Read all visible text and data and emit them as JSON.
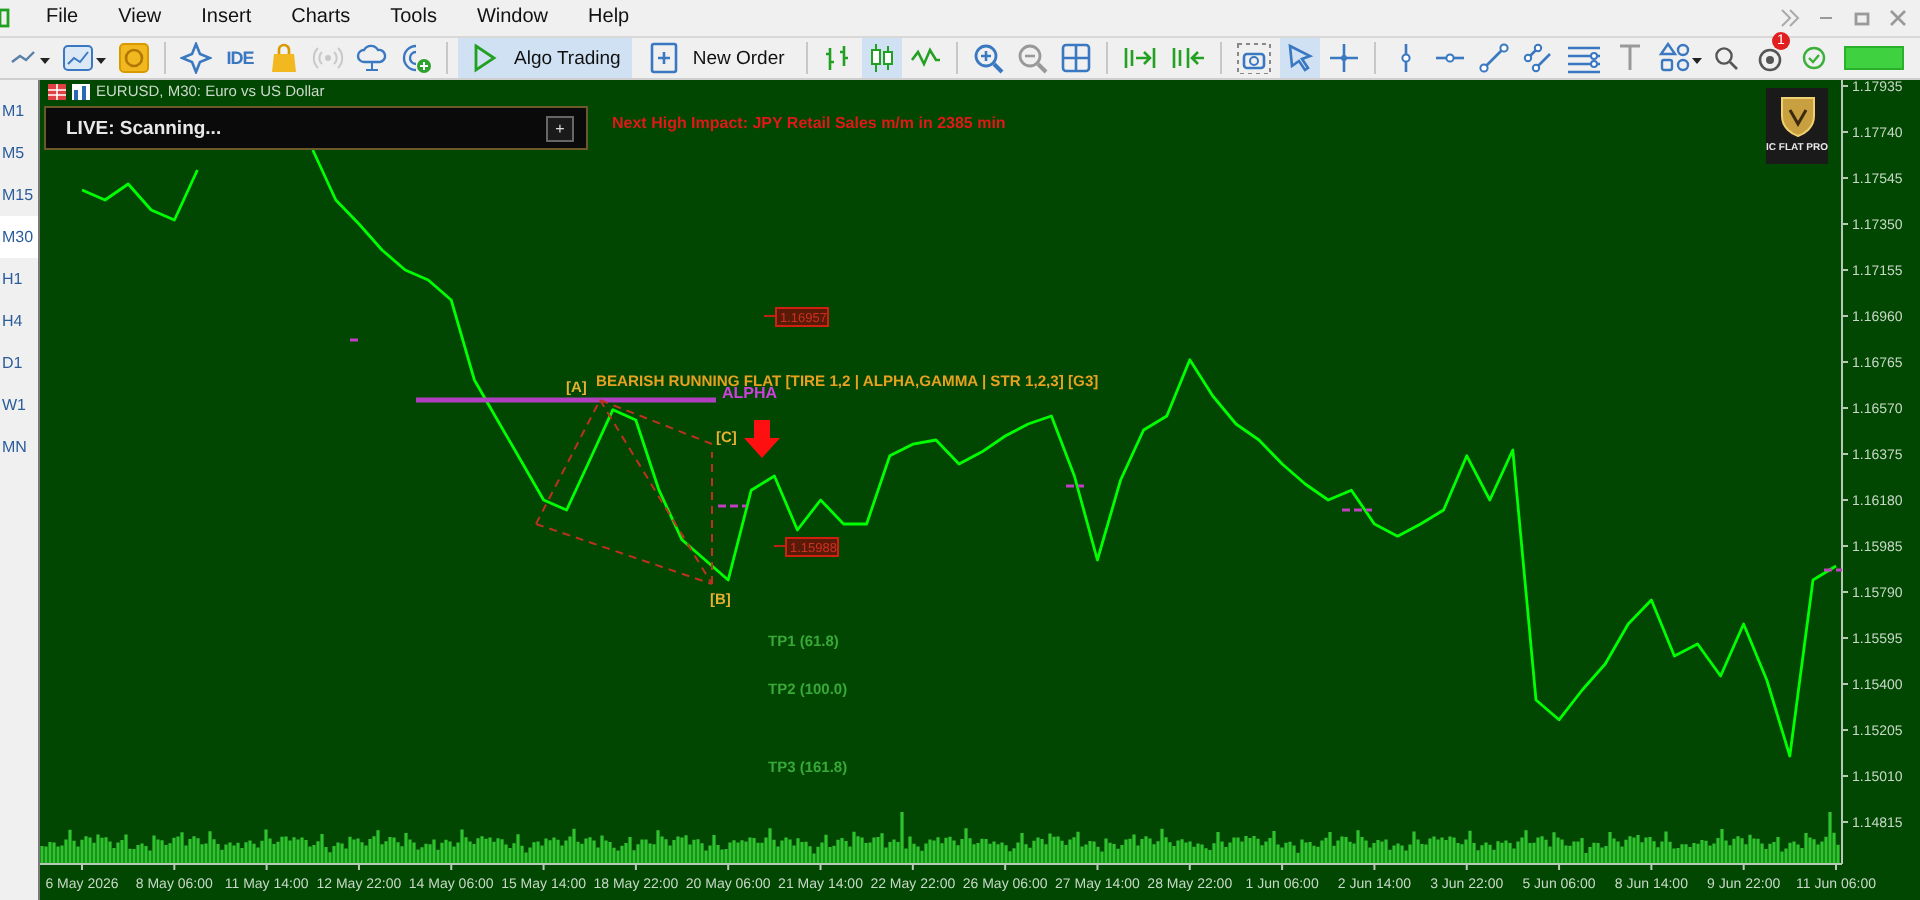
{
  "menu": [
    "File",
    "View",
    "Insert",
    "Charts",
    "Tools",
    "Window",
    "Help"
  ],
  "toolbar": [
    {
      "kind": "icon",
      "selected": false,
      "disabled": false
    },
    {
      "kind": "icon",
      "selected": false,
      "disabled": false
    },
    {
      "kind": "icon",
      "selected": false,
      "disabled": false
    },
    {
      "kind": "separator"
    },
    {
      "kind": "icon",
      "selected": false,
      "disabled": false
    },
    {
      "kind": "text_icon",
      "label": "IDE",
      "selected": false,
      "disabled": false
    },
    {
      "kind": "icon",
      "selected": false,
      "disabled": false
    },
    {
      "kind": "icon",
      "selected": false,
      "disabled": true
    },
    {
      "kind": "icon",
      "selected": false,
      "disabled": false
    },
    {
      "kind": "icon",
      "selected": false,
      "disabled": false
    },
    {
      "kind": "separator"
    },
    {
      "kind": "button",
      "label": "Algo Trading",
      "selected": true,
      "disabled": false
    },
    {
      "kind": "button",
      "label": "New Order",
      "selected": false,
      "disabled": false
    },
    {
      "kind": "separator"
    },
    {
      "kind": "icon",
      "selected": false,
      "disabled": false
    },
    {
      "kind": "icon",
      "selected": true,
      "disabled": false
    },
    {
      "kind": "icon",
      "selected": false,
      "disabled": false
    },
    {
      "kind": "separator"
    },
    {
      "kind": "icon",
      "selected": false,
      "disabled": false
    },
    {
      "kind": "icon",
      "selected": false,
      "disabled": false
    },
    {
      "kind": "icon",
      "selected": false,
      "disabled": false
    },
    {
      "kind": "separator"
    },
    {
      "kind": "icon",
      "selected": false,
      "disabled": false
    },
    {
      "kind": "icon",
      "selected": false,
      "disabled": false
    },
    {
      "kind": "separator"
    },
    {
      "kind": "icon",
      "selected": false,
      "disabled": false
    },
    {
      "kind": "icon",
      "selected": true,
      "disabled": false
    },
    {
      "kind": "icon",
      "selected": false,
      "disabled": false
    },
    {
      "kind": "separator"
    },
    {
      "kind": "icon",
      "selected": false,
      "disabled": false
    },
    {
      "kind": "icon",
      "selected": false,
      "disabled": false
    },
    {
      "kind": "icon",
      "selected": false,
      "disabled": false
    },
    {
      "kind": "icon",
      "selected": false,
      "disabled": false
    },
    {
      "kind": "icon",
      "selected": false,
      "disabled": false
    },
    {
      "kind": "icon",
      "selected": false,
      "disabled": false
    },
    {
      "kind": "icon",
      "selected": false,
      "disabled": false
    }
  ],
  "status": {
    "notifications": "1"
  },
  "timeframes": [
    {
      "label": "M1",
      "selected": false
    },
    {
      "label": "M5",
      "selected": false
    },
    {
      "label": "M15",
      "selected": false
    },
    {
      "label": "M30",
      "selected": true
    },
    {
      "label": "H1",
      "selected": false
    },
    {
      "label": "H4",
      "selected": false
    },
    {
      "label": "D1",
      "selected": false
    },
    {
      "label": "W1",
      "selected": false
    },
    {
      "label": "MN",
      "selected": false
    }
  ],
  "chart": {
    "title": "EURUSD, M30: Euro vs US Dollar",
    "live_panel": {
      "text": "LIVE: Scanning...",
      "button": "+"
    },
    "news": "Next High Impact: JPY Retail Sales m/m in 2385 min",
    "logo": "IC FLAT PRO",
    "pattern": {
      "title": "BEARISH RUNNING FLAT [TIRE 1,2 | ALPHA,GAMMA | STR 1,2,3] [G3]",
      "level_label": "ALPHA",
      "points": [
        {
          "label": "[A]"
        },
        {
          "label": "[C]"
        },
        {
          "label": "[B]"
        }
      ],
      "price_tags": [
        {
          "label": "1.16957"
        },
        {
          "label": "1.15988"
        }
      ],
      "targets": [
        {
          "label": "TP1 (61.8)"
        },
        {
          "label": "TP2 (100.0)"
        },
        {
          "label": "TP3 (161.8)"
        }
      ]
    },
    "chart_data": {
      "type": "line",
      "categories": [
        "6 May 2026",
        null,
        null,
        null,
        "8 May 06:00",
        null,
        null,
        null,
        "11 May 14:00",
        null,
        null,
        null,
        "12 May 22:00",
        null,
        null,
        null,
        "14 May 06:00",
        null,
        null,
        null,
        "15 May 14:00",
        null,
        null,
        null,
        "18 May 22:00",
        null,
        null,
        null,
        "20 May 06:00",
        null,
        null,
        null,
        "21 May 14:00",
        null,
        null,
        null,
        "22 May 22:00",
        null,
        null,
        null,
        "26 May 06:00",
        null,
        null,
        null,
        "27 May 14:00",
        null,
        null,
        null,
        "28 May 22:00",
        null,
        null,
        null,
        "1 Jun 06:00",
        null,
        null,
        null,
        "2 Jun 14:00",
        null,
        null,
        null,
        "3 Jun 22:00",
        null,
        null,
        null,
        "5 Jun 06:00",
        null,
        null,
        null,
        "8 Jun 14:00",
        null,
        null,
        null,
        "9 Jun 22:00",
        null,
        null,
        null,
        "11 Jun 06:00"
      ],
      "series": [
        {
          "color": "#00ff00",
          "values": [
            1.17494,
            1.17452,
            1.1752,
            1.17409,
            1.17367,
            1.17579,
            null,
            null,
            null,
            null,
            1.17664,
            1.17452,
            1.1735,
            1.1724,
            1.17155,
            1.17113,
            1.17028,
            1.16689,
            1.16519,
            1.1635,
            1.1618,
            1.16138,
            1.1635,
            1.16562,
            1.16519,
            1.16222,
            1.16011,
            1.15926,
            1.15841,
            1.16222,
            1.16282,
            1.16053,
            1.1618,
            1.16078,
            1.16078,
            1.16367,
            1.16417,
            1.16434,
            1.16333,
            1.16384,
            1.16451,
            1.16502,
            1.16536,
            1.16282,
            1.15926,
            1.16265,
            1.16477,
            1.16536,
            1.16774,
            1.16621,
            1.16502,
            1.16434,
            1.16333,
            1.16248,
            1.1618,
            1.16222,
            1.16078,
            1.16027,
            1.16078,
            1.16138,
            1.16367,
            1.1618,
            1.16392,
            1.15332,
            1.15248,
            1.15375,
            1.15485,
            1.15654,
            1.15756,
            1.15519,
            1.1557,
            1.15434,
            1.15654,
            1.15417,
            1.15095,
            1.15841,
            1.159
          ]
        }
      ],
      "ylim": [
        1.14637,
        1.17952
      ],
      "yticks": [
        {
          "value": 1.17935,
          "label": "1.17935"
        },
        {
          "value": 1.1774,
          "label": "1.17740"
        },
        {
          "value": 1.17545,
          "label": "1.17545"
        },
        {
          "value": 1.1735,
          "label": "1.17350"
        },
        {
          "value": 1.17155,
          "label": "1.17155"
        },
        {
          "value": 1.1696,
          "label": "1.16960"
        },
        {
          "value": 1.16765,
          "label": "1.16765"
        },
        {
          "value": 1.1657,
          "label": "1.16570"
        },
        {
          "value": 1.16375,
          "label": "1.16375"
        },
        {
          "value": 1.1618,
          "label": "1.16180"
        },
        {
          "value": 1.15985,
          "label": "1.15985"
        },
        {
          "value": 1.1579,
          "label": "1.15790"
        },
        {
          "value": 1.15595,
          "label": "1.15595"
        },
        {
          "value": 1.154,
          "label": "1.15400"
        },
        {
          "value": 1.15205,
          "label": "1.15205"
        },
        {
          "value": 1.1501,
          "label": "1.15010"
        },
        {
          "value": 1.14815,
          "label": "1.14815"
        }
      ]
    }
  }
}
